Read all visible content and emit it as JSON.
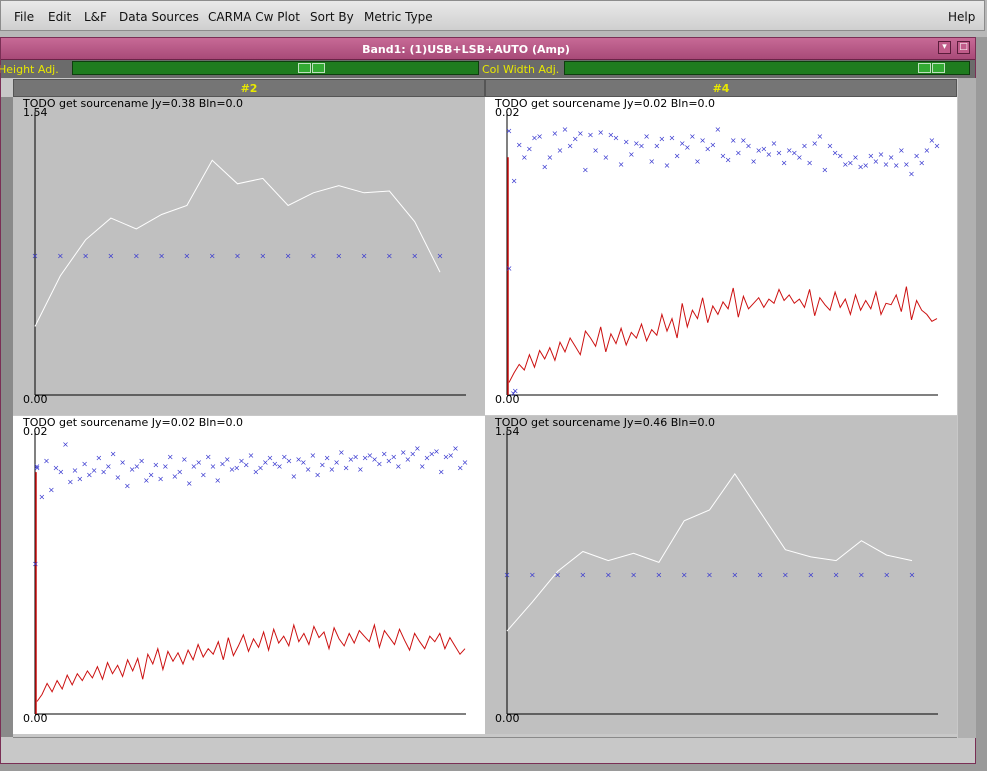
{
  "menubar": {
    "items": [
      "File",
      "Edit",
      "L&F",
      "Data Sources",
      "CARMA Cw Plot",
      "Sort By",
      "Metric Type"
    ],
    "help": "Help"
  },
  "window": {
    "title": "Band1: (1)USB+LSB+AUTO (Amp)",
    "row_height_label": "Height Adj.",
    "col_width_label": "Col Width Adj."
  },
  "columns": [
    "#2",
    "#4"
  ],
  "panels": [
    {
      "title": "TODO get sourcename Jy=0.38 Bln=0.0",
      "ymax": "1.54",
      "ymin": "0.00",
      "style": "gray",
      "chart_data": {
        "type": "line",
        "ylim": [
          0,
          1.54
        ],
        "series": [
          {
            "kind": "line",
            "color": "#ffffff",
            "values": [
              0.38,
              0.66,
              0.86,
              0.98,
              0.92,
              1.0,
              1.05,
              1.3,
              1.17,
              1.2,
              1.05,
              1.12,
              1.16,
              1.12,
              1.13,
              0.96,
              0.68
            ]
          },
          {
            "kind": "points",
            "color": "#3a3ad0",
            "values": [
              0.77,
              0.77,
              0.77,
              0.77,
              0.77,
              0.77,
              0.77,
              0.77,
              0.77,
              0.77,
              0.77,
              0.77,
              0.77,
              0.77,
              0.77,
              0.77,
              0.77
            ]
          }
        ]
      }
    },
    {
      "title": "TODO get sourcename Jy=0.02 Bln=0.0",
      "ymax": "0.02",
      "ymin": "0.00",
      "style": "white",
      "chart_data": {
        "type": "line",
        "ylim": [
          0,
          0.02
        ],
        "series": [
          {
            "kind": "line",
            "color": "#cc1111",
            "values": [
              0.0009,
              0.0016,
              0.0022,
              0.0018,
              0.0029,
              0.002,
              0.0032,
              0.0026,
              0.0034,
              0.0025,
              0.0038,
              0.0031,
              0.0041,
              0.0035,
              0.0029,
              0.0046,
              0.0041,
              0.0035,
              0.0049,
              0.0031,
              0.0044,
              0.0037,
              0.0048,
              0.0036,
              0.0045,
              0.0041,
              0.0051,
              0.0039,
              0.0047,
              0.0043,
              0.0058,
              0.0046,
              0.0055,
              0.0041,
              0.0066,
              0.0049,
              0.0061,
              0.0055,
              0.007,
              0.0052,
              0.0064,
              0.0058,
              0.0067,
              0.0062,
              0.0077,
              0.0056,
              0.0071,
              0.0062,
              0.0066,
              0.007,
              0.0063,
              0.0069,
              0.0066,
              0.0076,
              0.0068,
              0.0072,
              0.0066,
              0.0069,
              0.0063,
              0.0076,
              0.0057,
              0.007,
              0.0065,
              0.0061,
              0.0074,
              0.0063,
              0.0069,
              0.0058,
              0.0072,
              0.0061,
              0.0068,
              0.0062,
              0.0074,
              0.0058,
              0.0066,
              0.0065,
              0.0072,
              0.006,
              0.0078,
              0.0054,
              0.0068,
              0.0061,
              0.0058,
              0.0053,
              0.0055
            ]
          },
          {
            "kind": "points",
            "color": "#3a3ad0",
            "values": [
              0.019,
              0.0154,
              0.018,
              0.0171,
              0.0177,
              0.0185,
              0.0186,
              0.0164,
              0.0171,
              0.0188,
              0.0176,
              0.0191,
              0.0179,
              0.0184,
              0.0188,
              0.0162,
              0.0187,
              0.0176,
              0.0189,
              0.0171,
              0.0187,
              0.0185,
              0.0166,
              0.0182,
              0.0173,
              0.0181,
              0.0179,
              0.0186,
              0.0168,
              0.0179,
              0.0184,
              0.0165,
              0.0185,
              0.0172,
              0.0181,
              0.0178,
              0.0186,
              0.0168,
              0.0183,
              0.0177,
              0.018,
              0.0191,
              0.0172,
              0.0169,
              0.0183,
              0.0174,
              0.0183,
              0.0179,
              0.0168,
              0.0176,
              0.0177,
              0.0173,
              0.0181,
              0.0174,
              0.0167,
              0.0176,
              0.0174,
              0.0171,
              0.0179,
              0.0167,
              0.0181,
              0.0186,
              0.0162,
              0.0179,
              0.0174,
              0.0172,
              0.0166,
              0.0167,
              0.0171,
              0.0164,
              0.0165,
              0.0172,
              0.0168,
              0.0173,
              0.0166,
              0.0171,
              0.0165,
              0.0176,
              0.0166,
              0.0159,
              0.0172,
              0.0167,
              0.0176,
              0.0183,
              0.0179
            ]
          },
          {
            "kind": "spike",
            "color": "#cc1111",
            "x": 0.0,
            "values": [
              0.0,
              0.0171
            ]
          },
          {
            "kind": "lone-points",
            "color": "#3a3ad0",
            "points": [
              [
                0.005,
                0.0091
              ],
              [
                0.019,
                0.0003
              ],
              [
                0.015,
                0.0001
              ]
            ]
          }
        ]
      }
    },
    {
      "title": "TODO get sourcename Jy=0.02 Bln=0.0",
      "ymax": "0.02",
      "ymin": "0.00",
      "style": "white",
      "chart_data": {
        "type": "line",
        "ylim": [
          0,
          0.02
        ],
        "series": [
          {
            "kind": "line",
            "color": "#cc1111",
            "values": [
              0.0009,
              0.0014,
              0.0022,
              0.0016,
              0.0024,
              0.0018,
              0.0028,
              0.0021,
              0.0029,
              0.0024,
              0.0031,
              0.0026,
              0.0034,
              0.0025,
              0.0037,
              0.0029,
              0.0035,
              0.0027,
              0.0039,
              0.0031,
              0.004,
              0.0025,
              0.0043,
              0.0036,
              0.0047,
              0.0032,
              0.0045,
              0.0038,
              0.0044,
              0.0036,
              0.0046,
              0.0039,
              0.005,
              0.0041,
              0.0047,
              0.0043,
              0.0052,
              0.0039,
              0.0055,
              0.0042,
              0.0049,
              0.0057,
              0.0045,
              0.0054,
              0.0048,
              0.0059,
              0.0046,
              0.0061,
              0.0051,
              0.0056,
              0.0049,
              0.0064,
              0.0052,
              0.0058,
              0.005,
              0.0063,
              0.0055,
              0.0059,
              0.0047,
              0.0062,
              0.0054,
              0.0049,
              0.0058,
              0.0051,
              0.006,
              0.0056,
              0.0052,
              0.0064,
              0.0048,
              0.006,
              0.0055,
              0.005,
              0.0061,
              0.0053,
              0.0046,
              0.0058,
              0.0052,
              0.0047,
              0.0056,
              0.0052,
              0.0058,
              0.0047,
              0.0055,
              0.0049,
              0.0043,
              0.0047
            ]
          },
          {
            "kind": "points",
            "color": "#3a3ad0",
            "values": [
              0.0178,
              0.0156,
              0.0182,
              0.0161,
              0.0177,
              0.0174,
              0.0194,
              0.0167,
              0.0175,
              0.0169,
              0.018,
              0.0172,
              0.0175,
              0.0184,
              0.0174,
              0.0178,
              0.0187,
              0.017,
              0.0181,
              0.0164,
              0.0176,
              0.0178,
              0.0182,
              0.0168,
              0.0172,
              0.0179,
              0.0169,
              0.0178,
              0.0185,
              0.0171,
              0.0174,
              0.0183,
              0.0166,
              0.0178,
              0.0181,
              0.0172,
              0.0185,
              0.0178,
              0.0168,
              0.018,
              0.0183,
              0.0176,
              0.0177,
              0.0182,
              0.0179,
              0.0186,
              0.0174,
              0.0177,
              0.0181,
              0.0184,
              0.018,
              0.0178,
              0.0185,
              0.0182,
              0.0171,
              0.0183,
              0.0181,
              0.0176,
              0.0186,
              0.0172,
              0.0179,
              0.0184,
              0.0176,
              0.0181,
              0.0188,
              0.0177,
              0.0183,
              0.0185,
              0.0176,
              0.0184,
              0.0186,
              0.0183,
              0.018,
              0.0187,
              0.0182,
              0.0185,
              0.0178,
              0.0188,
              0.0183,
              0.0187,
              0.0191,
              0.0178,
              0.0184,
              0.0187,
              0.0189,
              0.0174,
              0.0185,
              0.0186,
              0.0191,
              0.0177,
              0.0181
            ]
          },
          {
            "kind": "spike",
            "color": "#cc1111",
            "x": 0.0,
            "values": [
              0.0,
              0.0174
            ]
          },
          {
            "kind": "lone-points",
            "color": "#3a3ad0",
            "points": [
              [
                0.001,
                0.0108
              ],
              [
                0.005,
                0.0177
              ]
            ]
          }
        ]
      }
    },
    {
      "title": "TODO get sourcename Jy=0.46 Bln=0.0",
      "ymax": "1.54",
      "ymin": "0.00",
      "style": "gray",
      "chart_data": {
        "type": "line",
        "ylim": [
          0,
          1.54
        ],
        "series": [
          {
            "kind": "line",
            "color": "#ffffff",
            "values": [
              0.46,
              0.62,
              0.79,
              0.9,
              0.85,
              0.89,
              0.84,
              1.07,
              1.13,
              1.33,
              1.12,
              0.91,
              0.87,
              0.85,
              0.96,
              0.88,
              0.85
            ]
          },
          {
            "kind": "points",
            "color": "#3a3ad0",
            "values": [
              0.77,
              0.77,
              0.77,
              0.77,
              0.77,
              0.77,
              0.77,
              0.77,
              0.77,
              0.77,
              0.77,
              0.77,
              0.77,
              0.77,
              0.77,
              0.77,
              0.77
            ]
          }
        ]
      }
    }
  ]
}
